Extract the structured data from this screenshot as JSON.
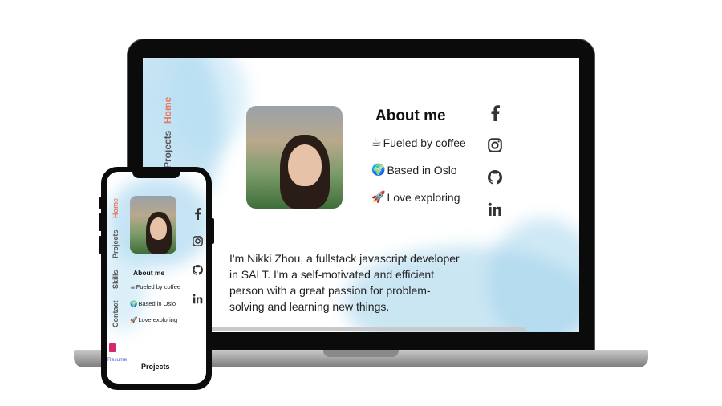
{
  "nav": {
    "home": "Home",
    "projects": "Projects",
    "skills": "Skills",
    "contact": "Contact"
  },
  "about": {
    "heading": "About me",
    "facts": [
      {
        "emoji": "☕",
        "text": "Fueled by coffee"
      },
      {
        "emoji": "🌍",
        "text": "Based in Oslo"
      },
      {
        "emoji": "🚀",
        "text": "Love exploring"
      }
    ],
    "bio": "I'm Nikki Zhou, a fullstack javascript developer in SALT. I'm a self-motivated and efficient person with a great passion for problem-solving and learning new things."
  },
  "social": [
    "facebook-icon",
    "instagram-icon",
    "github-icon",
    "linkedin-icon"
  ],
  "resume": {
    "label": "Resume"
  },
  "sections": {
    "projects_title": "Projects"
  },
  "colors": {
    "accent": "#e8785f",
    "nav_text": "#555555",
    "resume_icon": "#d6286f",
    "resume_link": "#3a5bd0",
    "watercolor": "#a0d2ee"
  }
}
